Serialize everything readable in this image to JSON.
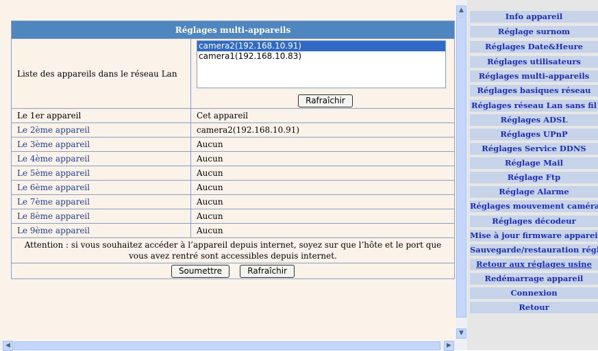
{
  "panel": {
    "title": "Réglages multi-appareils",
    "lan_label": "Liste des appareils dans le réseau Lan",
    "lan_list": [
      "camera2(192.168.10.91)",
      "camera1(192.168.10.83)"
    ],
    "lan_selected": "camera2(192.168.10.91)",
    "refresh_label": "Rafraîchir",
    "devices": [
      {
        "label": "Le 1er appareil",
        "value": "Cet appareil"
      },
      {
        "label": "Le 2ème appareil",
        "value": "camera2(192.168.10.91)"
      },
      {
        "label": "Le 3ème appareil",
        "value": "Aucun"
      },
      {
        "label": "Le 4ème appareil",
        "value": "Aucun"
      },
      {
        "label": "Le 5ème appareil",
        "value": "Aucun"
      },
      {
        "label": "Le 6ème appareil",
        "value": "Aucun"
      },
      {
        "label": "Le 7ème appareil",
        "value": "Aucun"
      },
      {
        "label": "Le 8ème appareil",
        "value": "Aucun"
      },
      {
        "label": "Le 9ème appareil",
        "value": "Aucun"
      }
    ],
    "attention": "Attention : si vous souhaitez accéder à l’appareil depuis internet, soyez sur que l’hôte et le port que vous avez rentré sont accessibles depuis internet.",
    "submit_label": "Soumettre",
    "refresh2_label": "Rafraîchir"
  },
  "menu": [
    "Info appareil",
    "Réglage surnom",
    "Réglages Date&Heure",
    "Réglages utilisateurs",
    "Réglages multi-appareils",
    "Réglages basiques réseau",
    "Réglages réseau Lan sans fil",
    "Réglages ADSL",
    "Réglages UPnP",
    "Réglages Service DDNS",
    "Réglage Mail",
    "Réglage Ftp",
    "Réglage Alarme",
    "Réglages mouvement caméra",
    "Réglages décodeur",
    "Mise à jour firmware appareil",
    "Sauvegarde/restauration réglages",
    "Retour aux réglages usine",
    "Redémarrage appareil",
    "Connexion",
    "Retour"
  ],
  "colors": {
    "panel_header": "#4f86bf",
    "content_bg": "#fbf3ea",
    "menu_item_bg": "#c7d3e8",
    "menu_text": "#1c2cbf",
    "device_label_text": "#1f3c9a",
    "selection": "#316ac5"
  },
  "icons": [
    "scroll-up-icon",
    "scroll-down-icon",
    "scroll-left-icon",
    "scroll-right-icon"
  ]
}
